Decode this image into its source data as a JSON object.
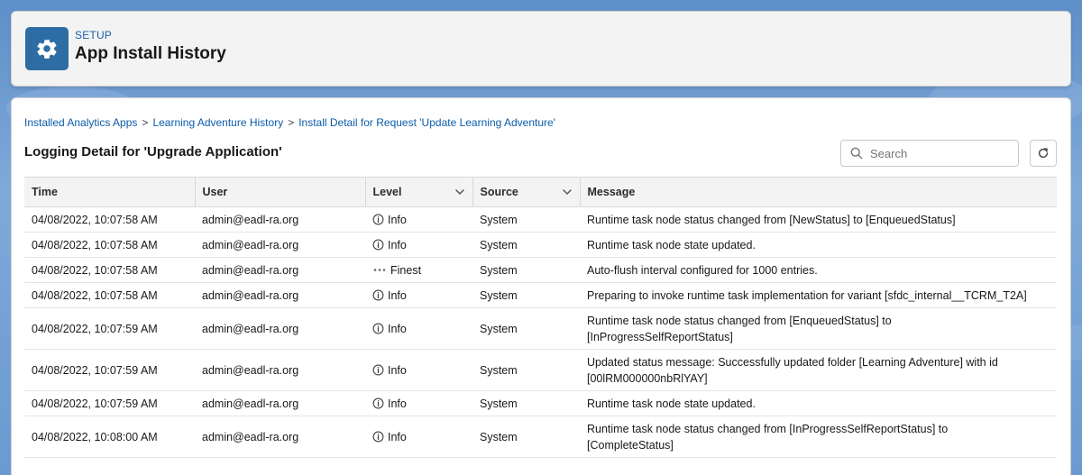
{
  "header": {
    "eyebrow": "SETUP",
    "title": "App Install History",
    "icon": "gear-icon",
    "icon_bg": "#2e6da4"
  },
  "breadcrumb": [
    "Installed Analytics Apps",
    "Learning Adventure History",
    "Install Detail for Request 'Update Learning Adventure'"
  ],
  "breadcrumb_sep": ">",
  "section_title": "Logging Detail for 'Upgrade Application'",
  "search": {
    "placeholder": "Search",
    "value": ""
  },
  "refresh_icon": "refresh-icon",
  "columns": [
    {
      "label": "Time",
      "sortable": false
    },
    {
      "label": "User",
      "sortable": false
    },
    {
      "label": "Level",
      "sortable": true
    },
    {
      "label": "Source",
      "sortable": true
    },
    {
      "label": "Message",
      "sortable": false
    }
  ],
  "rows": [
    {
      "time": "04/08/2022, 10:07:58 AM",
      "user": "admin@eadl-ra.org",
      "level": "Info",
      "level_icon": "info-icon",
      "source": "System",
      "message": [
        "Runtime task node status changed from [NewStatus] to [EnqueuedStatus]"
      ]
    },
    {
      "time": "04/08/2022, 10:07:58 AM",
      "user": "admin@eadl-ra.org",
      "level": "Info",
      "level_icon": "info-icon",
      "source": "System",
      "message": [
        "Runtime task node state updated."
      ]
    },
    {
      "time": "04/08/2022, 10:07:58 AM",
      "user": "admin@eadl-ra.org",
      "level": "Finest",
      "level_icon": "more-dots-icon",
      "source": "System",
      "message": [
        "Auto-flush interval configured for 1000 entries."
      ]
    },
    {
      "time": "04/08/2022, 10:07:58 AM",
      "user": "admin@eadl-ra.org",
      "level": "Info",
      "level_icon": "info-icon",
      "source": "System",
      "message": [
        "Preparing to invoke runtime task implementation for variant [sfdc_internal__TCRM_T2A]"
      ]
    },
    {
      "time": "04/08/2022, 10:07:59 AM",
      "user": "admin@eadl-ra.org",
      "level": "Info",
      "level_icon": "info-icon",
      "source": "System",
      "message": [
        "Runtime task node status changed from [EnqueuedStatus] to",
        "[InProgressSelfReportStatus]"
      ]
    },
    {
      "time": "04/08/2022, 10:07:59 AM",
      "user": "admin@eadl-ra.org",
      "level": "Info",
      "level_icon": "info-icon",
      "source": "System",
      "message": [
        "Updated status message: Successfully updated folder [Learning Adventure] with id",
        "[00lRM000000nbRlYAY]"
      ]
    },
    {
      "time": "04/08/2022, 10:07:59 AM",
      "user": "admin@eadl-ra.org",
      "level": "Info",
      "level_icon": "info-icon",
      "source": "System",
      "message": [
        "Runtime task node state updated."
      ]
    },
    {
      "time": "04/08/2022, 10:08:00 AM",
      "user": "admin@eadl-ra.org",
      "level": "Info",
      "level_icon": "info-icon",
      "source": "System",
      "message": [
        "Runtime task node status changed from [InProgressSelfReportStatus] to",
        "[CompleteStatus]"
      ]
    }
  ],
  "colors": {
    "link": "#0b5cab",
    "header_bg": "#f3f3f3",
    "table_header_bg": "#f3f3f3"
  }
}
